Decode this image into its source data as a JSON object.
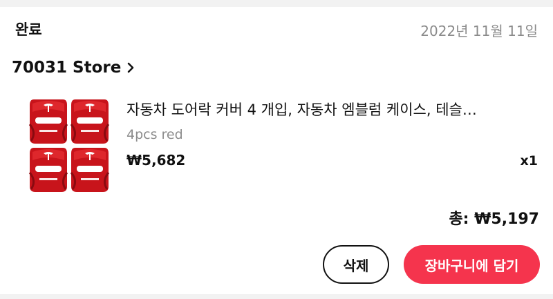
{
  "order": {
    "status": "완료",
    "date": "2022년 11월 11일"
  },
  "store": {
    "name": "70031 Store",
    "chevron_icon": "chevron-right-icon"
  },
  "product": {
    "title": "자동차 도어락 커버 4 개입, 자동차 엠블럼 케이스, 테슬…",
    "variant": "4pcs red",
    "price": "₩5,682",
    "quantity": "x1",
    "image_logo_text": "TESLA",
    "image_color": "#c8141b"
  },
  "summary": {
    "total": "총: ₩5,197"
  },
  "actions": {
    "delete_label": "삭제",
    "add_to_cart_label": "장바구니에 담기",
    "accent_color": "#f5344d"
  }
}
